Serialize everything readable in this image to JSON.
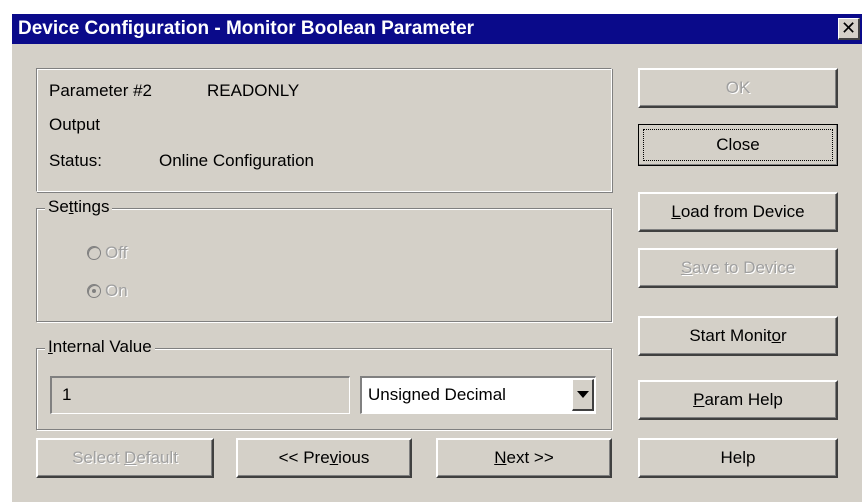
{
  "window": {
    "title": "Device Configuration - Monitor Boolean Parameter",
    "close_glyph": "✕"
  },
  "info": {
    "param_label": "Parameter #2",
    "param_access": "READONLY",
    "param_type": "Output",
    "status_label": "Status:",
    "status_value": "Online Configuration"
  },
  "settings": {
    "legend_pre": "Se",
    "legend_accel": "t",
    "legend_post": "tings",
    "options": [
      {
        "label": "Off",
        "selected": false
      },
      {
        "label": "On",
        "selected": true
      }
    ]
  },
  "internal_value": {
    "legend_accel": "I",
    "legend_post": "nternal Value",
    "value": "1",
    "format": "Unsigned Decimal"
  },
  "buttons": {
    "ok": "OK",
    "close": "Close",
    "load_accel": "L",
    "load_rest": "oad from Device",
    "save_accel": "S",
    "save_rest": "ave to Device",
    "start_pre": "Start Monit",
    "start_accel": "o",
    "start_post": "r",
    "param_help_accel": "P",
    "param_help_rest": "aram Help",
    "select_default_pre": "Select ",
    "select_default_accel": "D",
    "select_default_post": "efault",
    "previous_pre": "<< Pre",
    "previous_accel": "v",
    "previous_post": "ious",
    "next_accel": "N",
    "next_post": "ext >>",
    "help": "Help"
  }
}
